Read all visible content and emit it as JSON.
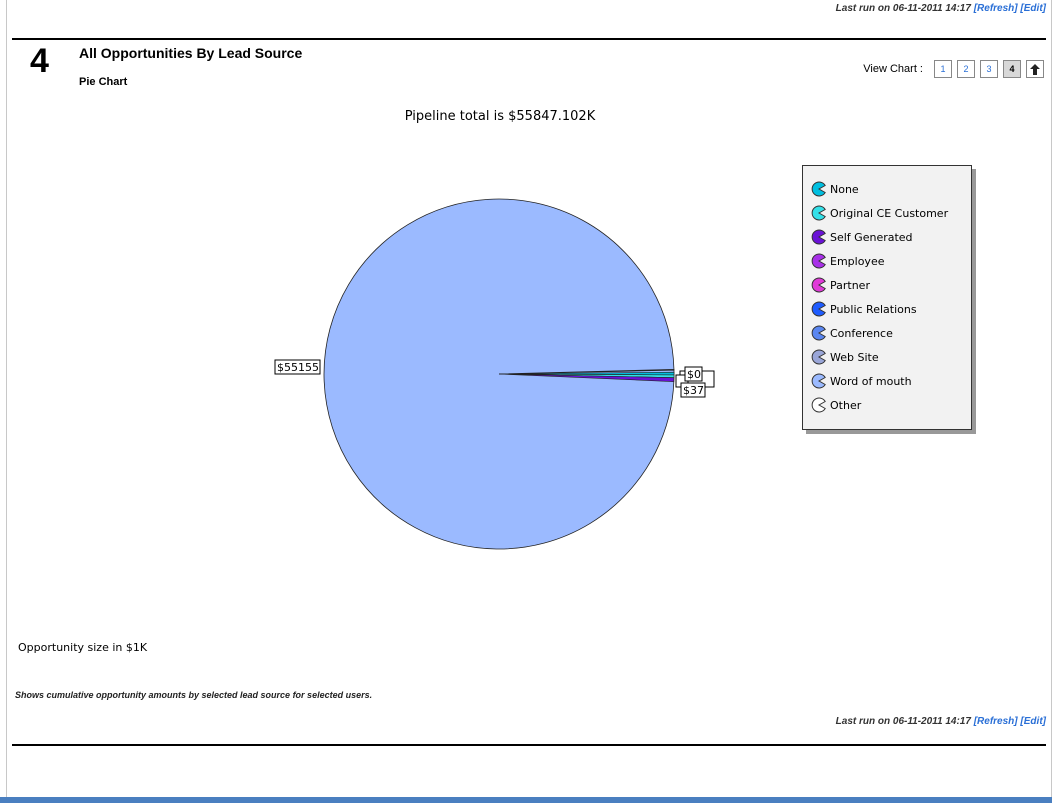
{
  "header": {
    "last_run_prefix": "Last run on 06-11-2011 14:17",
    "refresh_label": "Refresh",
    "edit_label": "Edit"
  },
  "chart_header": {
    "number": "4",
    "title": "All Opportunities By Lead Source",
    "subtitle": "Pie Chart"
  },
  "view_chart": {
    "label": "View Chart :",
    "buttons": [
      "1",
      "2",
      "3",
      "4"
    ],
    "active": "4",
    "up_glyph": "🡅"
  },
  "chart_data": {
    "type": "pie",
    "title": "Pipeline total is $55847.102K",
    "units_note": "Opportunity size in $1K",
    "slices": [
      {
        "name": "None",
        "value": 0,
        "color": "#00bfe0",
        "label": "$0"
      },
      {
        "name": "Original CE Customer",
        "value": 0,
        "color": "#33e0e8",
        "label": ""
      },
      {
        "name": "Self Generated",
        "value": 37,
        "color": "#6a12d6",
        "label": "$37"
      },
      {
        "name": "Employee",
        "value": 0,
        "color": "#a830e8",
        "label": ""
      },
      {
        "name": "Partner",
        "value": 0,
        "color": "#e03ad8",
        "label": ""
      },
      {
        "name": "Public Relations",
        "value": 0,
        "color": "#1e5cff",
        "label": ""
      },
      {
        "name": "Conference",
        "value": 0,
        "color": "#5a86f0",
        "label": ""
      },
      {
        "name": "Web Site",
        "value": 0,
        "color": "#9aa6d8",
        "label": ""
      },
      {
        "name": "Word of mouth",
        "value": 55155,
        "color": "#9bbaff",
        "label": "$55155"
      },
      {
        "name": "Other",
        "value": 0,
        "color": "#ffffff",
        "label": ""
      }
    ],
    "legend_position": "right"
  },
  "footer": {
    "description": "Shows cumulative opportunity amounts by selected lead source for selected users."
  }
}
